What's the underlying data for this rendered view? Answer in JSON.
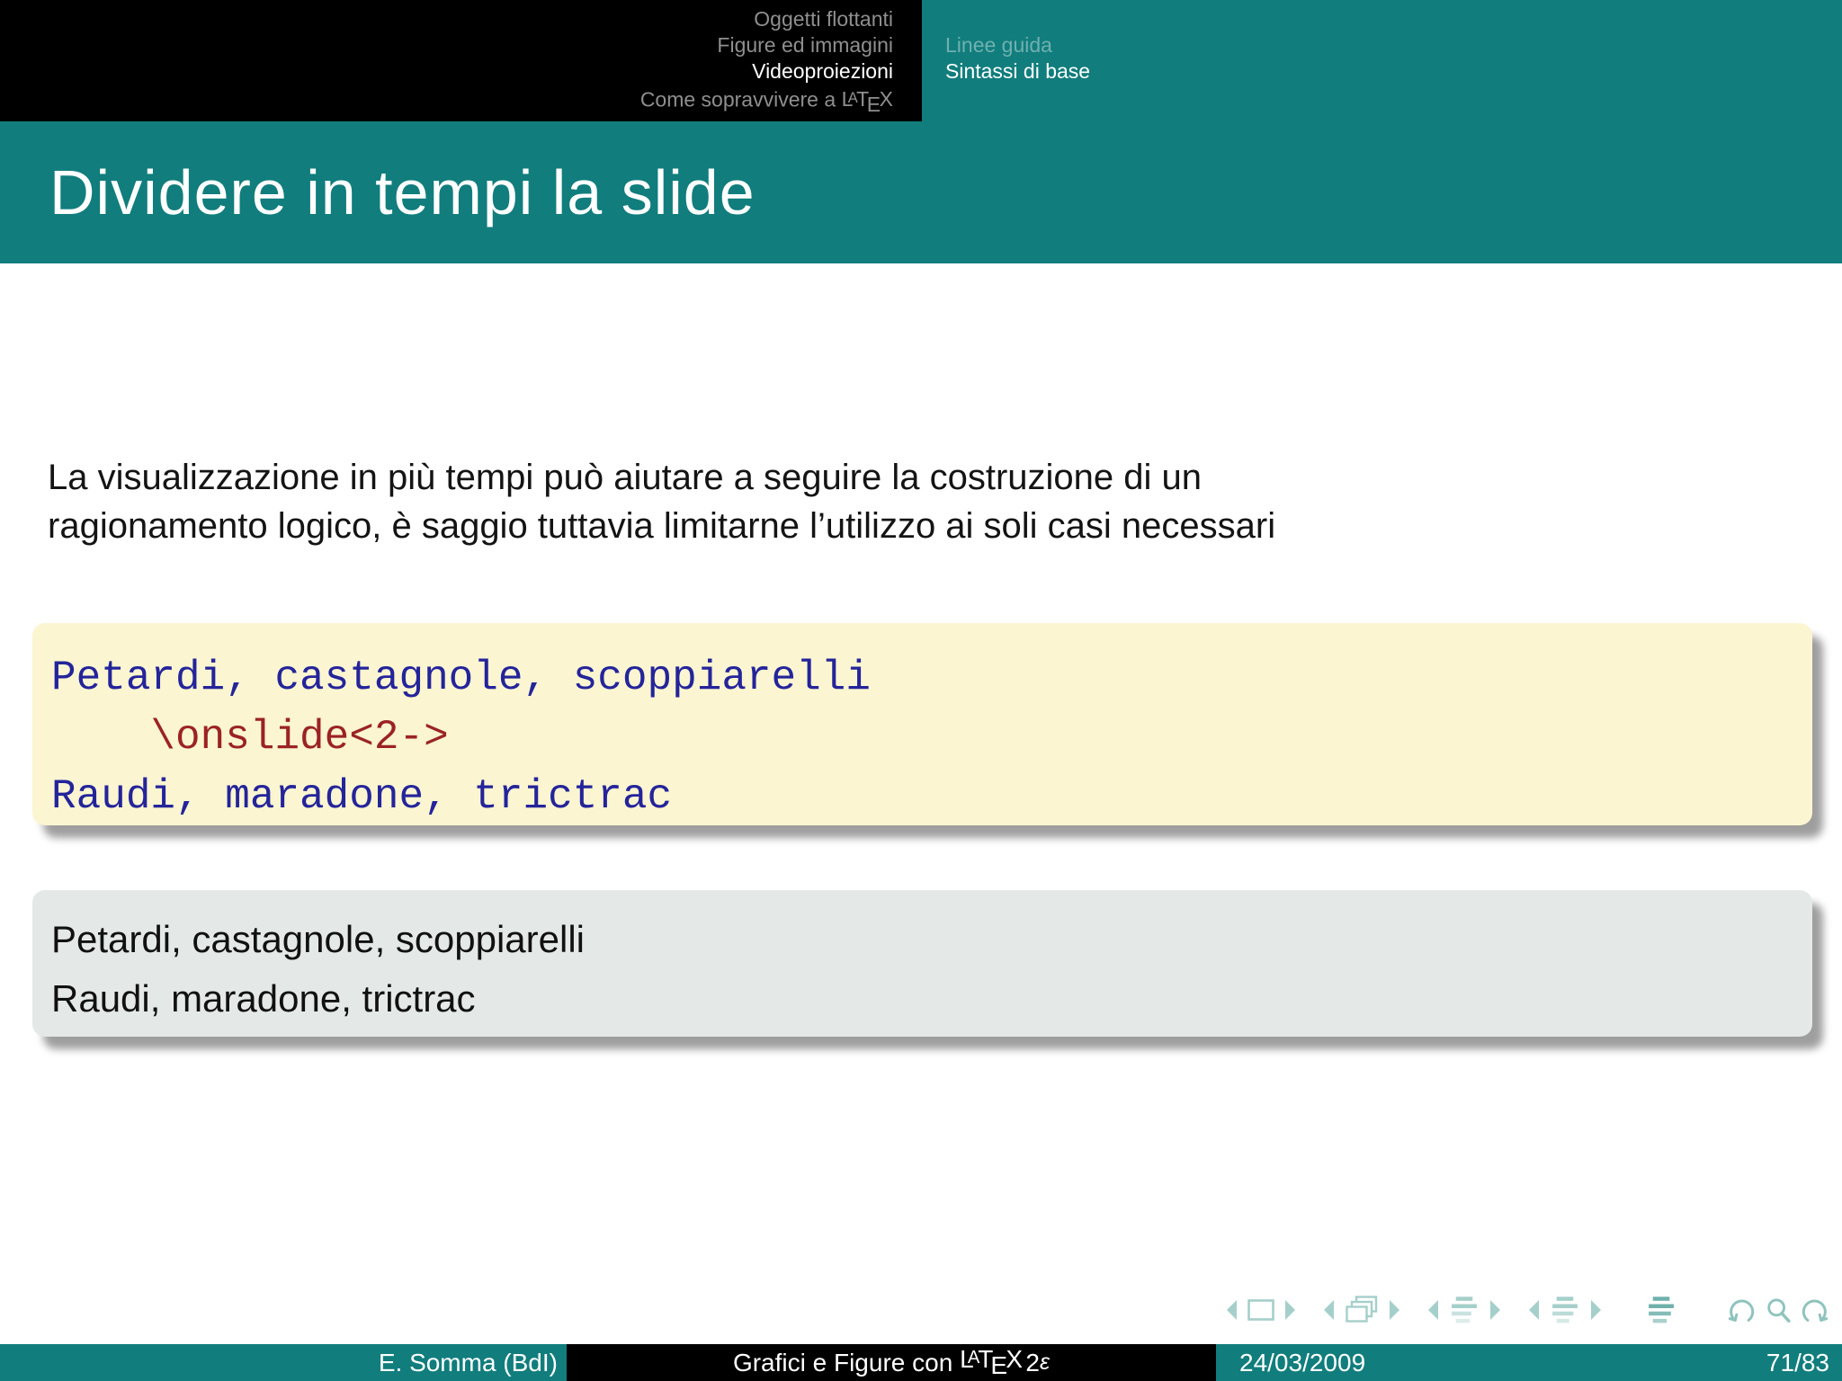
{
  "colors": {
    "teal": "#117D7D",
    "header_bg": "#000000",
    "inactive_section_text": "#8F8F8F",
    "inactive_subsection_text": "#70B0B0",
    "code_block_bg": "#FBF5D1",
    "code_blue": "#24249B",
    "code_red": "#9B2323",
    "example_block_bg": "#E4E9E7",
    "nav_icon": "#A5CFCA"
  },
  "header": {
    "sections": [
      {
        "label": "Oggetti flottanti",
        "active": false
      },
      {
        "label": "Figure ed immagini",
        "active": false
      },
      {
        "label": "Videoproiezioni",
        "active": true
      },
      {
        "label": "Come sopravvivere a",
        "active": false,
        "has_latex_logo": true
      }
    ],
    "subsections": [
      {
        "label": "Linee guida",
        "active": false
      },
      {
        "label": "Sintassi di base",
        "active": true
      }
    ]
  },
  "latex_logo": {
    "l1": "L",
    "l2": "A",
    "l3": "T",
    "l4": "E",
    "l5": "X"
  },
  "frametitle": "Dividere in tempi la slide",
  "body": {
    "line1": "La visualizzazione in più tempi può aiutare a seguire la costruzione di un",
    "line2": "ragionamento logico, è saggio tuttavia limitarne l’utilizzo ai soli casi necessari"
  },
  "code_block": {
    "line1": "Petardi, castagnole, scoppiarelli",
    "line2": "    \\onslide<2->",
    "line3": "Raudi, maradone, trictrac"
  },
  "example_block": {
    "line1": "Petardi, castagnole, scoppiarelli",
    "line2": "Raudi, maradone, trictrac"
  },
  "nav": {
    "icons": [
      "slide-prev",
      "slide",
      "slide-next",
      "frame-prev",
      "frame-stack",
      "frame-next",
      "subsection-prev",
      "subsection-list",
      "subsection-next",
      "section-prev",
      "section-list",
      "section-next",
      "appendix-list",
      "back",
      "find",
      "forward"
    ]
  },
  "footer": {
    "author": "E. Somma (BdI)",
    "title_prefix": "Grafici e Figure con",
    "title_number": "2",
    "title_subscript": "ε",
    "date": "24/03/2009",
    "page": "71/83"
  }
}
